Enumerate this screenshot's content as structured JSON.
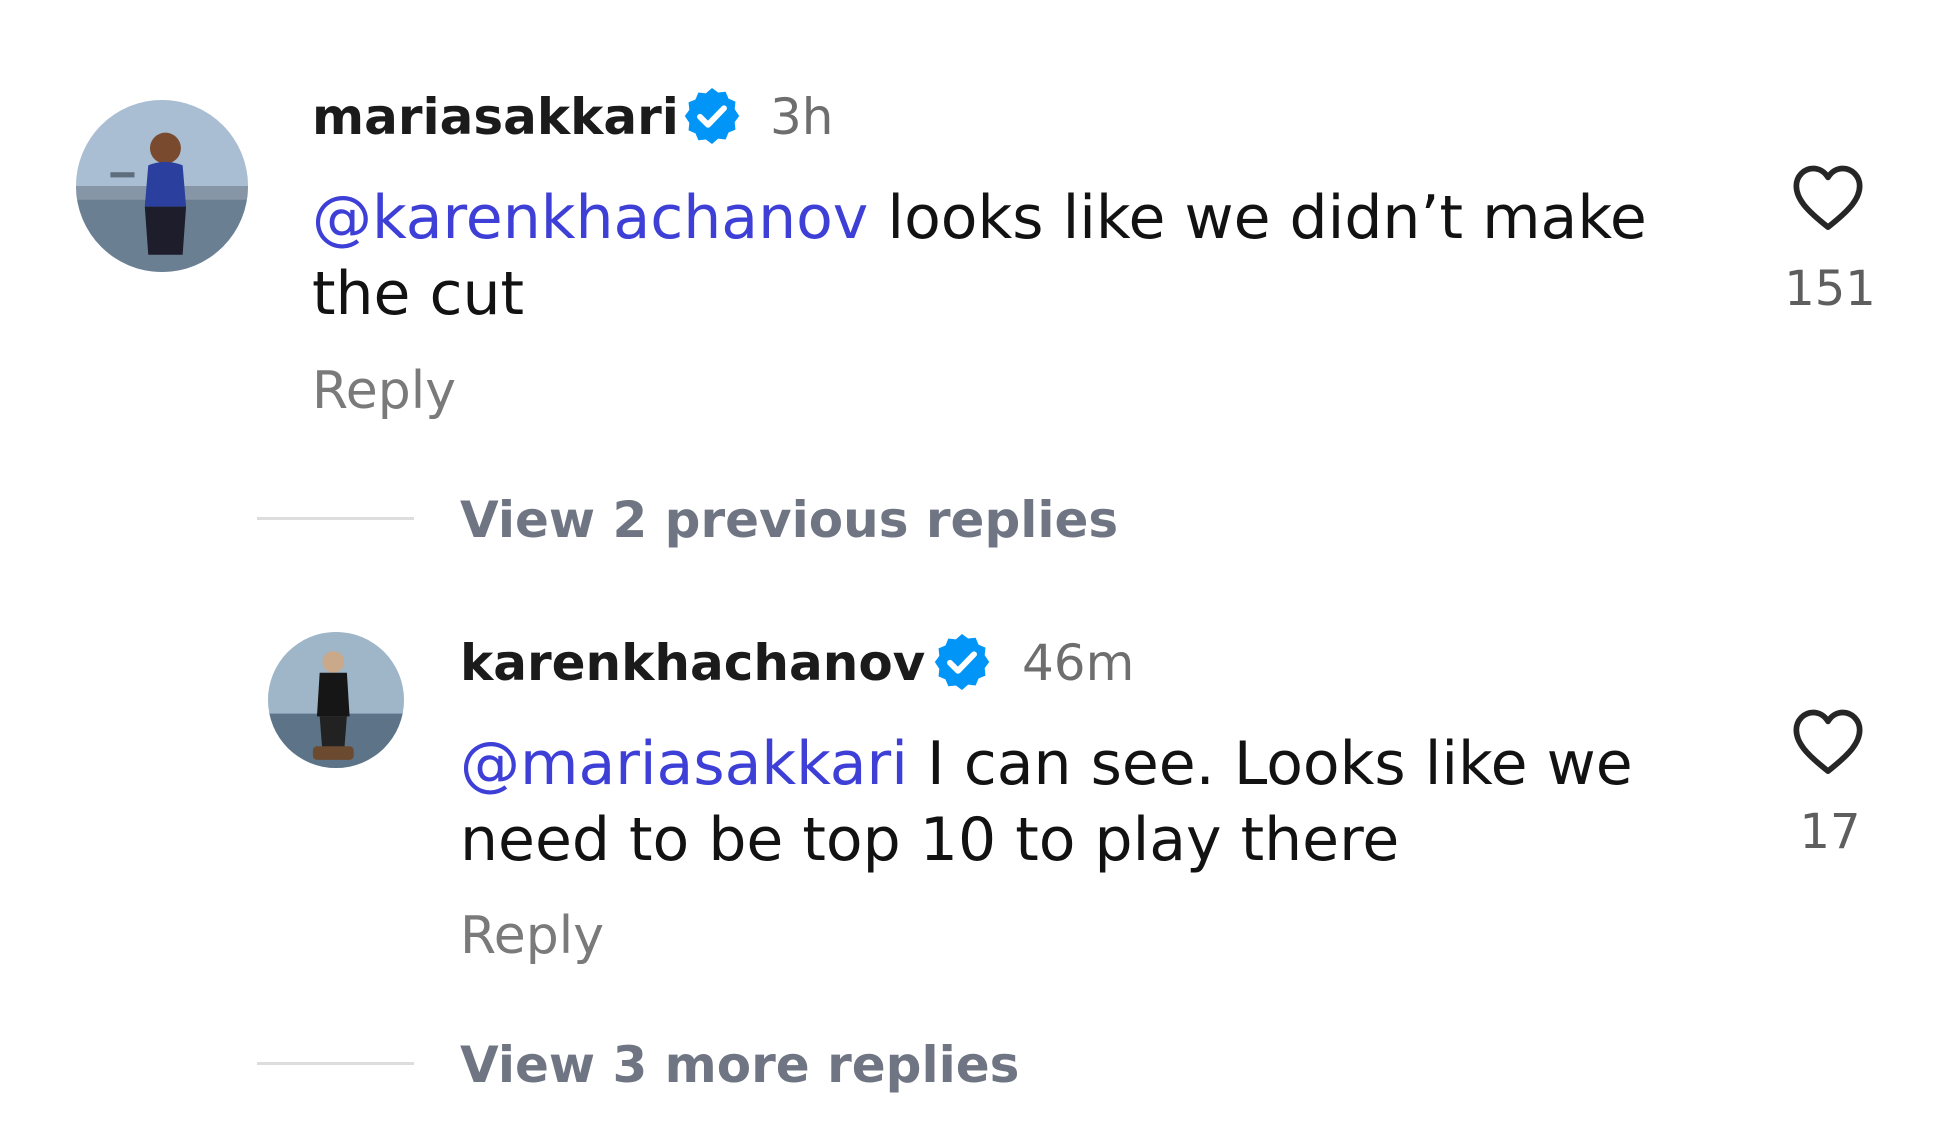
{
  "comments": [
    {
      "username": "mariasakkari",
      "time": "3h",
      "mention": "@karenkhachanov",
      "text_line1": " looks like we didn’t make",
      "text_line2": "the cut",
      "reply_label": "Reply",
      "like_count": "151"
    },
    {
      "username": "karenkhachanov",
      "time": "46m",
      "mention": "@mariasakkari",
      "text_line1": " I can see. Looks like we",
      "text_line2": "need to be top 10 to play there",
      "reply_label": "Reply",
      "like_count": "17"
    }
  ],
  "thread": {
    "view_previous": "View 2 previous replies",
    "view_more": "View 3 more replies"
  },
  "colors": {
    "mention": "#3d3fd6",
    "verified": "#0095f6",
    "muted": "#6f7582"
  }
}
